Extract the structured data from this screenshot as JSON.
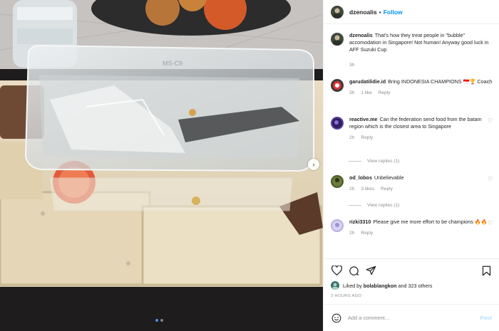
{
  "post": {
    "author": "dzenoalis",
    "follow_label": "Follow",
    "separator": "•",
    "caption": "That's how they treat people in \"bubble\" accomodation in Singapore! Not human! Anyway good luck in AFF Suzuki Cup",
    "caption_time": "3h"
  },
  "photo": {
    "box_label": "MS-C9",
    "carousel_next_icon": "chevron-right-icon",
    "slide_count": 2,
    "active_slide": 1
  },
  "comments": [
    {
      "user": "garudatilidie.id",
      "text": "Bring INDONESIA CHAMPIONS 🇮🇩🏆 Coach",
      "time": "3h",
      "likes": "1 like",
      "reply": "Reply",
      "avatar_color": "#3a3a3a"
    },
    {
      "user": "reactive.me",
      "text": "Can the federation send food from the batam region which is the closest area to Singapore",
      "time": "2h",
      "likes": "",
      "reply": "Reply",
      "view_replies": "View replies (1)",
      "avatar_color": "#5b3fa0"
    },
    {
      "user": "od_lobos",
      "text": "Unbelievable",
      "time": "2h",
      "likes": "3 likes",
      "reply": "Reply",
      "view_replies": "View replies (1)",
      "avatar_color": "#4a5a2a"
    },
    {
      "user": "rizki3310",
      "text": "Please give me more effort to be champions 🔥🔥",
      "time": "2h",
      "likes": "",
      "reply": "Reply",
      "avatar_color": "#b8b0e0"
    }
  ],
  "likes": {
    "prefix": "Liked by",
    "user": "bolablangkon",
    "suffix": "and 323 others"
  },
  "post_time": "3 HOURS AGO",
  "add_comment": {
    "placeholder": "Add a comment…",
    "post_label": "Post"
  },
  "colors": {
    "accent": "#0095f6",
    "muted": "#8e8e8e",
    "post_disabled": "#b2dffc"
  }
}
